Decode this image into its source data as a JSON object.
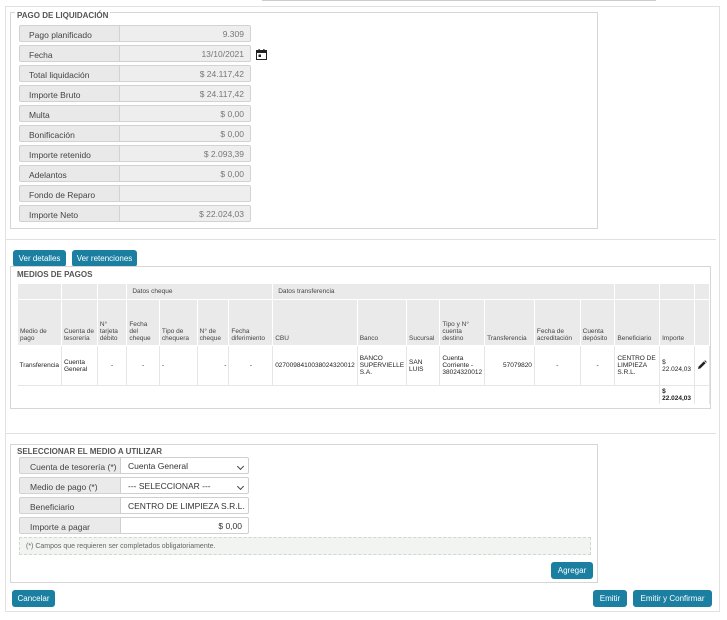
{
  "pago": {
    "legend": "PAGO DE LIQUIDACIÓN",
    "fields": [
      {
        "label": "Pago planificado",
        "value": "9.309"
      },
      {
        "label": "Fecha",
        "value": "13/10/2021"
      },
      {
        "label": "Total liquidación",
        "value": "$ 24.117,42"
      },
      {
        "label": "Importe Bruto",
        "value": "$ 24.117,42"
      },
      {
        "label": "Multa",
        "value": "$ 0,00"
      },
      {
        "label": "Bonificación",
        "value": "$ 0,00"
      },
      {
        "label": "Importe retenido",
        "value": "$ 2.093,39"
      },
      {
        "label": "Adelantos",
        "value": "$ 0,00"
      },
      {
        "label": "Fondo de Reparo",
        "value": ""
      },
      {
        "label": "Importe Neto",
        "value": "$ 22.024,03"
      }
    ],
    "calendar_icon": "calendar-icon"
  },
  "actions": {
    "ver_detalles": "Ver detalles",
    "ver_retenciones": "Ver retenciones"
  },
  "medios": {
    "legend": "MEDIOS DE PAGOS",
    "group_headers": {
      "cheque": "Datos cheque",
      "transferencia": "Datos transferencia"
    },
    "columns": {
      "medio": "Medio de pago",
      "cuenta": "Cuenta de tesorería",
      "tarjeta": "N° tarjeta débito",
      "fecha_cheque": "Fecha del cheque",
      "tipo_chequera": "Tipo de chequera",
      "nro_cheque": "N° de cheque",
      "fecha_dif": "Fecha diferimiento",
      "cbu": "CBU",
      "banco": "Banco",
      "sucursal": "Sucursal",
      "tipo_cuenta": "Tipo y N° cuenta destino",
      "transferencia": "Transferencia",
      "fecha_acred": "Fecha de acreditación",
      "cuenta_dep": "Cuenta depósito",
      "beneficiario": "Beneficiario",
      "importe": "Importe"
    },
    "row": {
      "medio": "Transferencia",
      "cuenta": "Cuenta General",
      "tarjeta": "-",
      "fecha_cheque": "-",
      "tipo_chequera": "-",
      "nro_cheque": "-",
      "fecha_dif": "-",
      "cbu": "0270098410038024320012",
      "banco": "BANCO SUPERVIELLE S.A.",
      "sucursal": "SAN LUIS",
      "tipo_cuenta": "Cuenta Corriente - 38024320012",
      "transferencia": "57079820",
      "fecha_acred": "-",
      "cuenta_dep": "-",
      "beneficiario": "CENTRO DE LIMPIEZA S.R.L.",
      "importe": "$ 22.024,03"
    },
    "total": "$ 22.024,03",
    "edit_icon": "pencil-icon"
  },
  "seleccionar": {
    "legend": "SELECCIONAR EL MEDIO A UTILIZAR",
    "cuenta_label": "Cuenta de tesorería (*)",
    "cuenta_value": "Cuenta General",
    "medio_label": "Medio de pago (*)",
    "medio_value": "--- SELECCIONAR ---",
    "beneficiario_label": "Beneficiario",
    "beneficiario_value": "CENTRO DE LIMPIEZA S.R.L.",
    "importe_label": "Importe a pagar",
    "importe_value": "$ 0,00",
    "note": "(*) Campos que requieren ser completados obligatoriamente.",
    "agregar": "Agregar"
  },
  "footer": {
    "cancelar": "Cancelar",
    "emitir": "Emitir",
    "emitir_confirmar": "Emitir y Confirmar"
  },
  "colors": {
    "accent": "#1a7fa0",
    "label_bg": "#e9e9e9"
  }
}
